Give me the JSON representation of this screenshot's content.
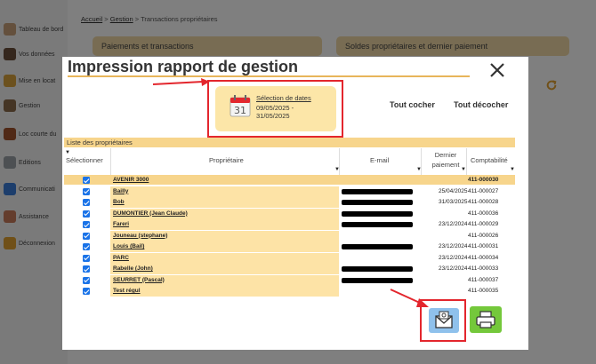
{
  "sidebar": {
    "items": [
      {
        "label": "Tableau de bord",
        "icon": "dashboard-icon",
        "color": "#c9a17a"
      },
      {
        "label": "Vos données",
        "icon": "user-icon",
        "color": "#6a4f3a"
      },
      {
        "label": "Mise en locat",
        "icon": "key-icon",
        "color": "#d9a23c"
      },
      {
        "label": "Gestion",
        "icon": "tools-icon",
        "color": "#8b6a4a"
      },
      {
        "label": "Loc courte du",
        "icon": "suitcase-icon",
        "color": "#a0522d"
      },
      {
        "label": "Editions",
        "icon": "print-icon",
        "color": "#9aa0a6"
      },
      {
        "label": "Communicati",
        "icon": "chat-icon",
        "color": "#3b7dd8"
      },
      {
        "label": "Assistance",
        "icon": "support-icon",
        "color": "#c97a5a"
      },
      {
        "label": "Déconnexion",
        "icon": "logout-icon",
        "color": "#e0a030"
      }
    ]
  },
  "breadcrumb": {
    "home": "Accueil",
    "section": "Gestion",
    "current": "Transactions propriétaires",
    "sep": ">"
  },
  "sections": {
    "payments": "Paiements et transactions",
    "balances": "Soldes propriétaires et dernier paiement"
  },
  "modal": {
    "title": "Impression rapport de gestion",
    "date_icon_day": "31",
    "date_link": "Sélection de dates",
    "date_range": "09/05/2025 - 31/05/2025",
    "check_all": "Tout cocher",
    "uncheck_all": "Tout décocher",
    "list_header": "Liste des propriétaires",
    "columns": {
      "select": "Sélectionner",
      "owner": "Propriétaire",
      "email": "E-mail",
      "last_payment": "Dernier paiement",
      "accounting": "Comptabilité"
    },
    "rows": [
      {
        "owner": "AVENIR 3000",
        "email_redacted": false,
        "date": "",
        "account": "411-000030"
      },
      {
        "owner": "Bailly",
        "email_redacted": true,
        "date": "25/04/2025",
        "account": "411-000027"
      },
      {
        "owner": "Bob",
        "email_redacted": true,
        "date": "31/03/2025",
        "account": "411-000028"
      },
      {
        "owner": "DUMONTIER (Jean Claude)",
        "email_redacted": true,
        "date": "",
        "account": "411-000036"
      },
      {
        "owner": "Fareri",
        "email_redacted": true,
        "date": "23/12/2024",
        "account": "411-000029"
      },
      {
        "owner": "Jouneau (stephane)",
        "email_redacted": false,
        "date": "",
        "account": "411-000026"
      },
      {
        "owner": "Louis (Bail)",
        "email_redacted": true,
        "date": "23/12/2024",
        "account": "411-000031"
      },
      {
        "owner": "PARC",
        "email_redacted": false,
        "date": "23/12/2024",
        "account": "411-000034"
      },
      {
        "owner": "Rabelle (John)",
        "email_redacted": true,
        "date": "23/12/2024",
        "account": "411-000033"
      },
      {
        "owner": "SEURRET (Pascal)",
        "email_redacted": true,
        "date": "",
        "account": "411-000037"
      },
      {
        "owner": "Test régul",
        "email_redacted": false,
        "date": "",
        "account": "411-000035"
      }
    ]
  },
  "colors": {
    "accent": "#e8b55a",
    "highlight": "#e3262d",
    "row_bg": "#fde3a6",
    "mail_btn": "#8fc1ec",
    "print_btn": "#74c83b"
  }
}
